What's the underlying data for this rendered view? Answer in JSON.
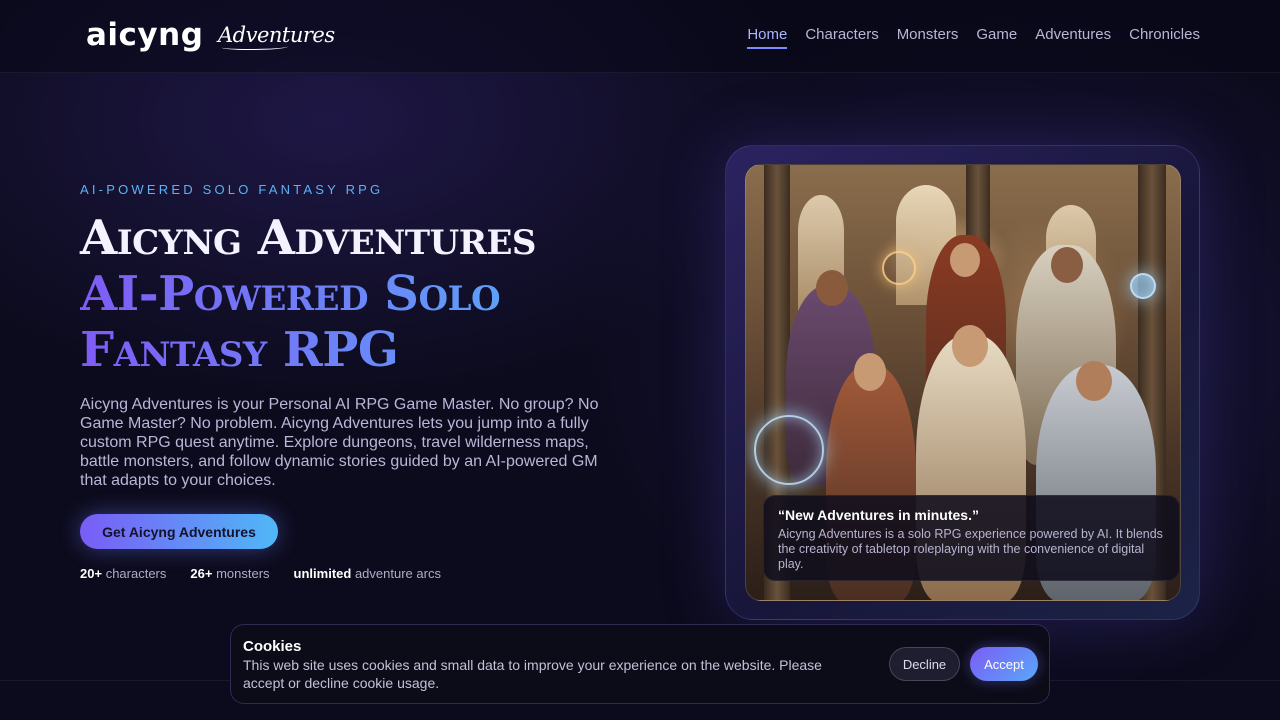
{
  "header": {
    "logo_text": "aicyng",
    "logo_sub": "Adventures",
    "nav": [
      {
        "label": "Home",
        "active": true
      },
      {
        "label": "Characters"
      },
      {
        "label": "Monsters"
      },
      {
        "label": "Game"
      },
      {
        "label": "Adventures"
      },
      {
        "label": "Chronicles"
      }
    ]
  },
  "hero": {
    "eyebrow": "AI-POWERED SOLO FANTASY RPG",
    "title_line1": "Aicyng Adventures",
    "title_line2": "AI-Powered Solo",
    "title_line3": "Fantasy RPG",
    "description": "Aicyng Adventures is your Personal AI RPG Game Master. No group? No Game Master? No problem. Aicyng Adventures lets you jump into a fully custom RPG quest anytime. Explore dungeons, travel wilderness maps, battle monsters, and follow dynamic stories guided by an AI-powered GM that adapts to your choices.",
    "cta_label": "Get Aicyng Adventures",
    "stats": [
      {
        "value": "20+",
        "label": "characters"
      },
      {
        "value": "26+",
        "label": "monsters"
      },
      {
        "value": "unlimited",
        "label": "adventure arcs"
      }
    ]
  },
  "card": {
    "quote_title": "“New Adventures in minutes.”",
    "quote_text": "Aicyng Adventures is a solo RPG experience powered by AI. It blends the creativity of tabletop roleplaying with the convenience of digital play."
  },
  "cookie": {
    "title": "Cookies",
    "text": "This web site uses cookies and small data to improve your experience on the website. Please accept or decline cookie usage.",
    "decline_label": "Decline",
    "accept_label": "Accept"
  },
  "colors": {
    "background": "#0c0b1d",
    "accent_purple": "#7a5cf6",
    "accent_blue": "#4fb8f7",
    "eyebrow": "#5ab3f5"
  }
}
